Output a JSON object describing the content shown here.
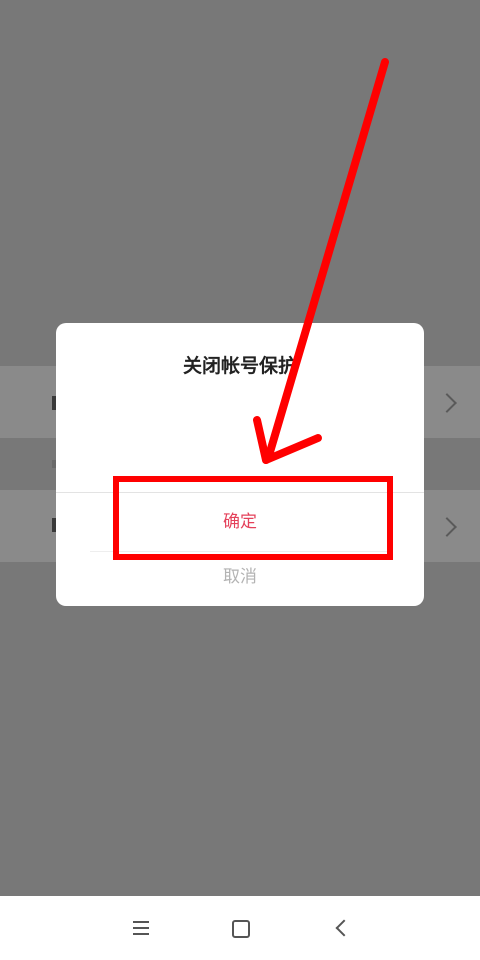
{
  "dialog": {
    "title": "关闭帐号保护",
    "confirm_label": "确定",
    "cancel_label": "取消"
  },
  "colors": {
    "scrim": "#787878",
    "confirm": "#e4415a",
    "cancel": "#b3b3b3",
    "annotation": "#ff0000"
  },
  "nav": {
    "menu_icon": "menu-icon",
    "home_icon": "home-icon",
    "back_icon": "back-icon"
  }
}
